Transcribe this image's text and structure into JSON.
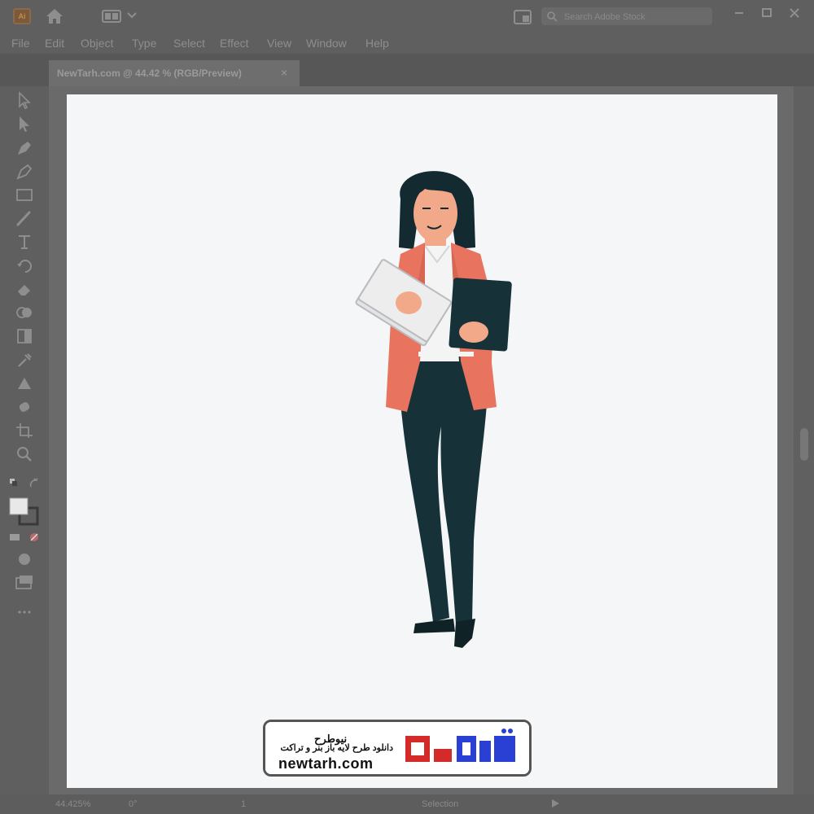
{
  "app": {
    "logo_text": "Ai"
  },
  "search": {
    "placeholder": "Search Adobe Stock"
  },
  "menu": [
    "File",
    "Edit",
    "Object",
    "Type",
    "Select",
    "Effect",
    "View",
    "Window",
    "Help"
  ],
  "document_tab": {
    "title": "NewTarh.com @ 44.42 % (RGB/Preview)",
    "close": "×"
  },
  "status_bar": {
    "zoom": "44.425%",
    "rotation": "0°",
    "page": "1",
    "tool": "Selection"
  },
  "watermark": {
    "brand": "نیوطرح",
    "tagline": "دانلود طرح لایه باز بنر و تراکت",
    "url": "newtarh.com",
    "logo_text": "نیوطرح"
  },
  "colors": {
    "blazer": "#e8735f",
    "pants": "#163238",
    "hair": "#122a30",
    "skin": "#f2a98a",
    "shirt": "#f4f4f4",
    "watermark_red": "#d42a2a",
    "watermark_blue": "#2a3fd4"
  }
}
